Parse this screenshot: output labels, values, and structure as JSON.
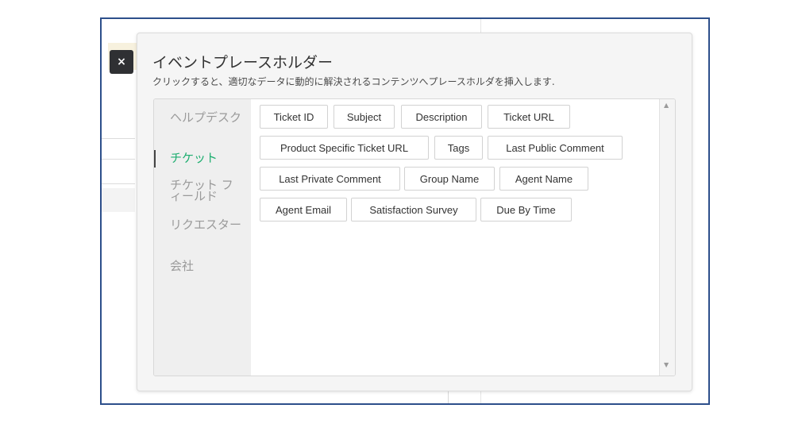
{
  "dialog": {
    "title": "イベントプレースホルダー",
    "subtitle": "クリックすると、適切なデータに動的に解決されるコンテンツへプレースホルダを挿入します.",
    "close_label": "×"
  },
  "sidebar": {
    "items": [
      {
        "label": "ヘルプデスク"
      },
      {
        "label": "チケット",
        "active": true
      },
      {
        "label": "チケット フィールド"
      },
      {
        "label": "リクエスター"
      },
      {
        "label": "会社"
      }
    ]
  },
  "placeholders": [
    "Ticket ID",
    "Subject",
    "Description",
    "Ticket URL",
    "Product Specific Ticket URL",
    "Tags",
    "Last Public Comment",
    "Last Private Comment",
    "Group Name",
    "Agent Name",
    "Agent Email",
    "Satisfaction Survey",
    "Due By Time"
  ],
  "scrollbar": {
    "up": "▲",
    "down": "▼"
  },
  "colors": {
    "active": "#1eae70",
    "frame": "#2d4f8b"
  }
}
